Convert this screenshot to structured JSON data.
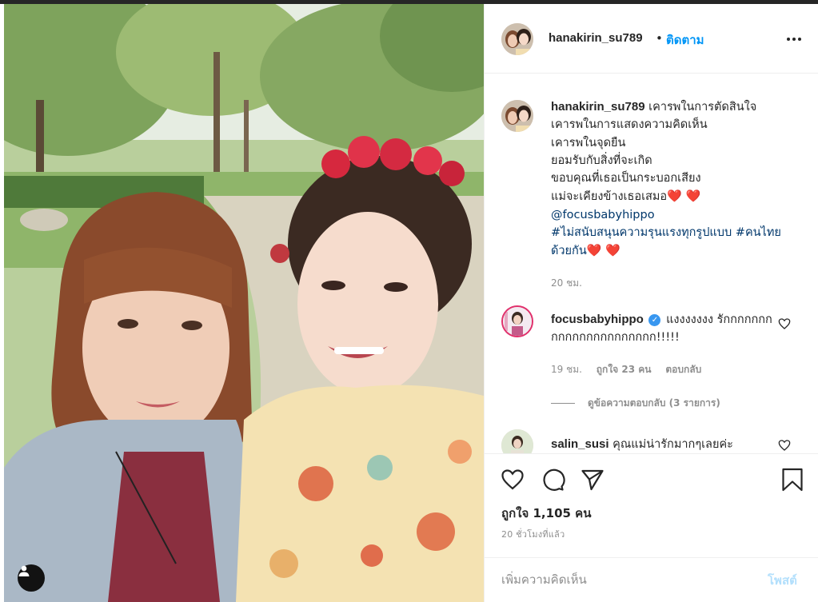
{
  "post": {
    "author": "hanakirin_su789",
    "follow_separator": "•",
    "follow_label": "ติดตาม"
  },
  "caption": {
    "username": "hanakirin_su789",
    "lines": [
      "เคารพในการตัดสินใจ",
      "เคารพในการแสดงความคิดเห็น",
      "เคารพในจุดยืน",
      "ยอมรับกับสิ่งที่จะเกิด",
      "ขอบคุณที่เธอเป็นกระบอกเสียง",
      "แม่จะเคียงข้างเธอเสมอ"
    ],
    "hearts": "❤️ ❤️",
    "mention": "@focusbabyhippo",
    "hashtags": "#ไม่สนับสนุนความรุนแรงทุกรูปแบบ #คนไทยด้วยกัน",
    "hashtag_hearts": "❤️ ❤️",
    "time": "20 ชม."
  },
  "comments": [
    {
      "username": "focusbabyhippo",
      "verified": "✓",
      "text": "แงงงงงงง รักกกกกกกกกกกกกกกกกกกกกก!!!!!",
      "time": "19 ชม.",
      "likes": "ถูกใจ 23 คน",
      "reply_label": "ตอบกลับ",
      "view_replies": "ดูข้อความตอบกลับ (3 รายการ)"
    },
    {
      "username": "salin_susi",
      "text": "คุณแม่น่ารักมากๆเลยค่ะ"
    }
  ],
  "actions": {
    "likes_count": "ถูกใจ 1,105 คน",
    "post_time": "20 ชั่วโมงที่แล้ว"
  },
  "add_comment": {
    "placeholder": "เพิ่มความคิดเห็น",
    "post_label": "โพสต์"
  },
  "colors": {
    "accent": "#0095f6",
    "link": "#00376b",
    "muted": "#8e8e8e",
    "heart": "#ed1c24",
    "post_disabled": "#b2dffc"
  },
  "icons": [
    "more-icon",
    "heart-icon",
    "comment-icon",
    "share-icon",
    "bookmark-icon",
    "user-tag-icon",
    "verified-icon"
  ]
}
